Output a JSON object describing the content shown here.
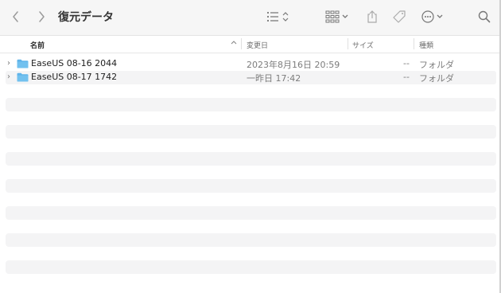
{
  "toolbar": {
    "title": "復元データ",
    "icons": {
      "back": "chevron-left-icon",
      "forward": "chevron-right-icon",
      "list_view": "list-view-icon",
      "gallery_view": "grid-view-icon",
      "share": "share-icon",
      "tag": "tag-icon",
      "more": "ellipsis-circle-icon",
      "search": "search-icon"
    }
  },
  "columns": {
    "name": "名前",
    "date": "変更日",
    "size": "サイズ",
    "kind": "種類"
  },
  "files": [
    {
      "name": "EaseUS 08-16 2044",
      "date": "2023年8月16日 20:59",
      "size": "--",
      "kind": "フォルダ"
    },
    {
      "name": "EaseUS 08-17 1742",
      "date": "一昨日 17:42",
      "size": "--",
      "kind": "フォルダ"
    }
  ],
  "colors": {
    "folder": "#5fb4ea",
    "stripe": "#f4f4f5",
    "toolbar_bg": "#f6f6f6"
  }
}
